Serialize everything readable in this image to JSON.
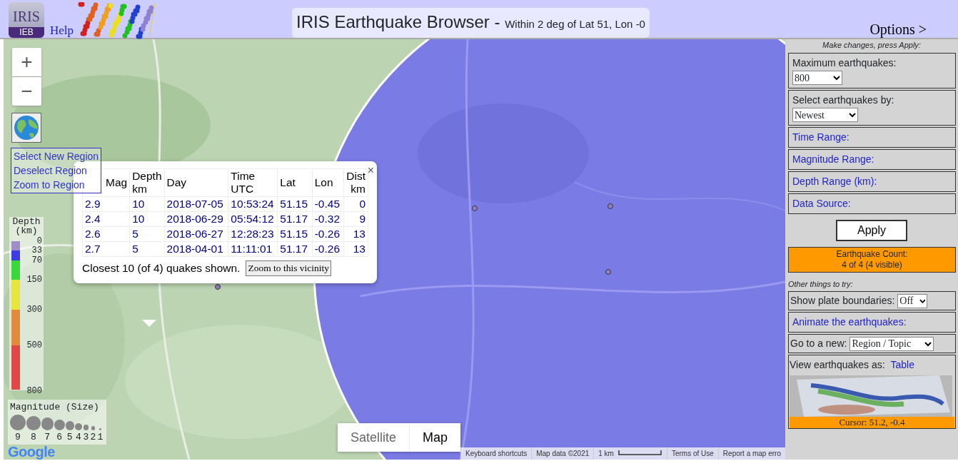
{
  "header": {
    "logo_top": "IRIS",
    "logo_bottom": "IEB",
    "help": "Help",
    "title": "IRIS Earthquake Browser -",
    "subtitle": "Within 2 deg of Lat 51, Lon -0",
    "options": "Options >"
  },
  "map_controls": {
    "zoom_in": "+",
    "zoom_out": "−",
    "region_menu": [
      "Select New Region",
      "Deselect Region",
      "Zoom to Region"
    ]
  },
  "popup": {
    "close": "×",
    "columns": [
      "Mag",
      "Depth km",
      "Day",
      "Time UTC",
      "Lat",
      "Lon",
      "Dist km"
    ],
    "rows": [
      [
        "2.9",
        "10",
        "2018-07-05",
        "10:53:24",
        "51.15",
        "-0.45",
        "0"
      ],
      [
        "2.4",
        "10",
        "2018-06-29",
        "05:54:12",
        "51.17",
        "-0.32",
        "9"
      ],
      [
        "2.6",
        "5",
        "2018-06-27",
        "12:28:23",
        "51.15",
        "-0.26",
        "13"
      ],
      [
        "2.7",
        "5",
        "2018-04-01",
        "11:11:01",
        "51.17",
        "-0.26",
        "13"
      ]
    ],
    "footer": "Closest 10 (of 4) quakes shown.",
    "button": "Zoom to this vicinity"
  },
  "depth_legend": {
    "title": "Depth (km)",
    "bands": [
      {
        "label": "0",
        "color": "#a08cc8"
      },
      {
        "label": "33",
        "color": "#3c3ce0"
      },
      {
        "label": "70",
        "color": "#3ad83a"
      },
      {
        "label": "150",
        "color": "#e6e640"
      },
      {
        "label": "300",
        "color": "#e08c3c"
      },
      {
        "label": "500",
        "color": "#e04848"
      }
    ],
    "end_label": "800"
  },
  "magnitude_legend": {
    "title": "Magnitude (Size)",
    "labels": [
      "9",
      "8",
      "7",
      "6",
      "5",
      "4",
      "3",
      "2",
      "1"
    ]
  },
  "map_type": [
    {
      "label": "Satellite",
      "selected": false
    },
    {
      "label": "Map",
      "selected": true
    }
  ],
  "google": "Google",
  "attribution": [
    "Keyboard shortcuts",
    "Map data ©2021",
    "1 km",
    "Terms of Use",
    "Report a map erro"
  ],
  "sidebar": {
    "hint": "Make changes, press Apply:",
    "panels": [
      {
        "kind": "select",
        "label": "Maximum earthquakes:",
        "value": "800"
      },
      {
        "kind": "select",
        "label": "Select earthquakes by:",
        "value": "Newest"
      },
      {
        "kind": "link",
        "label": "Time Range:"
      },
      {
        "kind": "link",
        "label": "Magnitude Range:"
      },
      {
        "kind": "link",
        "label": "Depth Range (km):"
      },
      {
        "kind": "link",
        "label": "Data Source:"
      }
    ],
    "apply": "Apply",
    "count_title": "Earthquake Count:",
    "count_value": "4 of 4 (4 visible)",
    "other_hint": "Other things to try:",
    "others": [
      {
        "kind": "inline_select",
        "label": "Show plate boundaries:",
        "value": "Off"
      },
      {
        "kind": "link",
        "label": "Animate the earthquakes:"
      },
      {
        "kind": "inline_select",
        "label": "Go to a new:",
        "value": "Region / Topic"
      },
      {
        "kind": "view",
        "label": "View earthquakes as:",
        "link": "Table",
        "cursor": "Cursor: 51.2, -0.4"
      }
    ]
  }
}
